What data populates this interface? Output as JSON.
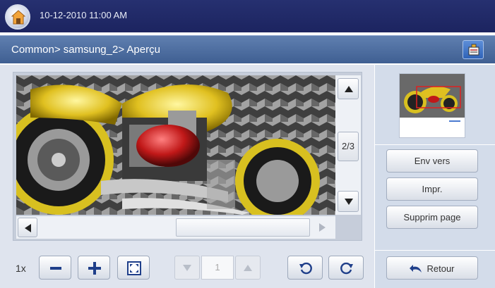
{
  "status": {
    "datetime": "10-12-2010 11:00 AM"
  },
  "breadcrumb": {
    "path": "Common> samsung_2> Aperçu"
  },
  "viewer": {
    "page_indicator": "2/3"
  },
  "toolbar": {
    "zoom_label": "1x",
    "page_field": "1"
  },
  "side": {
    "env_vers": "Env vers",
    "impr": "Impr.",
    "supprim_page": "Supprim page",
    "retour": "Retour"
  },
  "colors": {
    "top_bar": "#1c2460",
    "crumb_bar": "#4a6aa0",
    "accent_blue": "#2f63b8"
  }
}
